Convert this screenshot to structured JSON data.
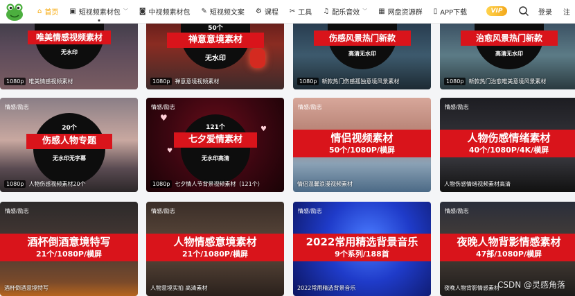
{
  "header": {
    "nav": [
      {
        "icon": "home-icon",
        "glyph": "⌂",
        "label": "首页"
      },
      {
        "icon": "video-icon",
        "glyph": "▣",
        "label": "短视频素材包",
        "caret": "﹀"
      },
      {
        "icon": "camera-icon",
        "glyph": "◙",
        "label": "中视频素材包"
      },
      {
        "icon": "pen-icon",
        "glyph": "✎",
        "label": "短视频文案"
      },
      {
        "icon": "gear-icon",
        "glyph": "⚙",
        "label": "课程"
      },
      {
        "icon": "tool-icon",
        "glyph": "✂",
        "label": "工具"
      },
      {
        "icon": "music-icon",
        "glyph": "♫",
        "label": "配乐音效",
        "caret": "﹀"
      },
      {
        "icon": "grid-icon",
        "glyph": "▦",
        "label": "网盘资源群"
      },
      {
        "icon": "phone-icon",
        "glyph": "▯",
        "label": "APP下载"
      }
    ],
    "vip_label": "VIP",
    "login": "登录",
    "register": "注"
  },
  "colors": {
    "accent": "#f7a600",
    "banner_red": "#d9141b"
  },
  "cards": [
    {
      "caption": "唯美情感视频素材",
      "res": "1080p",
      "circle_title": "唯美情感视频素材",
      "circle_sub": "无水印"
    },
    {
      "caption": "禅意意境视频素材",
      "res": "1080p",
      "circle_top": "50个",
      "circle_title": "禅意意境素材",
      "circle_sub": "无水印"
    },
    {
      "caption": "新款热门伤感孤独意境风景素材",
      "res": "1080p",
      "circle_title": "伤感风景热门新款",
      "circle_sub": "高清无水印"
    },
    {
      "caption": "新款热门治愈唯美意境风景素材",
      "res": "1080p",
      "circle_title": "治愈风景热门新款",
      "circle_sub": "高清无水印"
    },
    {
      "tag": "情感/励志",
      "caption": "人物伤感视频素材20个",
      "res": "1080p",
      "circle_top": "20个",
      "circle_title": "伤感人物专题",
      "circle_sub": "无水印无字幕"
    },
    {
      "tag": "情感/励志",
      "caption": "七夕情人节背景视频素材（121个）",
      "res": "1080p",
      "circle_top": "121个",
      "circle_title": "七夕爱情素材",
      "circle_sub": "无水印高清"
    },
    {
      "tag": "情感/励志",
      "caption": "情侣温馨浪漫视频素材",
      "banner_title": "情侣视频素材",
      "banner_sub": "50个/1080P/横屏"
    },
    {
      "tag": "情感/励志",
      "caption": "人物伤感情绪视频素材高清",
      "banner_title": "人物伤感情绪素材",
      "banner_sub": "40个/1080P/4K/横屏"
    },
    {
      "tag": "情感/励志",
      "caption": "酒杯倒酒意境特写",
      "banner_title": "酒杯倒酒意境特写",
      "banner_sub": "21个/1080P/横屏"
    },
    {
      "tag": "情感/励志",
      "caption": "人物意境实拍 高清素材",
      "banner_title": "人物情感意境素材",
      "banner_sub": "21个/1080P/横屏"
    },
    {
      "tag": "情感/励志",
      "caption": "2022常用精选背景音乐",
      "banner_title": "2022常用精选背景音乐",
      "banner_sub": "9个系列/188首"
    },
    {
      "tag": "情感/励志",
      "caption": "夜晚人物背影情感素材",
      "banner_title": "夜晚人物背影情感素材",
      "banner_sub": "47部/1080P/横屏"
    }
  ],
  "watermark": "CSDN @灵感角落"
}
